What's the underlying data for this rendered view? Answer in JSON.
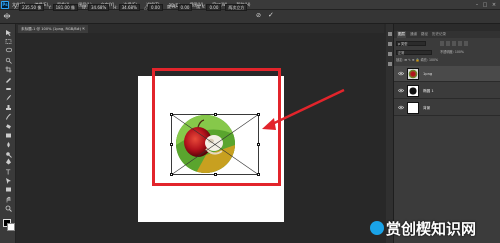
{
  "app": {
    "logo": "Ps"
  },
  "menu": {
    "items": [
      "文件(F)",
      "编辑(E)",
      "图像(I)",
      "图层(L)",
      "文字(Y)",
      "选择(S)",
      "滤镜(T)",
      "3D(D)",
      "视图(V)",
      "窗口(W)",
      "帮助(H)"
    ]
  },
  "options": {
    "fields": [
      {
        "label": "X:",
        "value": "235.50 像"
      },
      {
        "label": "Y:",
        "value": "181.00 像"
      },
      {
        "label": "W:",
        "value": "34.68%"
      },
      {
        "label": "H:",
        "value": "34.68%"
      },
      {
        "label": "△",
        "value": "0.00"
      },
      {
        "label": "度 H:",
        "value": "0.00"
      },
      {
        "label": "度 V:",
        "value": "0.00"
      }
    ],
    "interp": "两次立方",
    "cancel_icon": "⊘",
    "commit_icon": "✓"
  },
  "document": {
    "tab_title": "未标题-1 @ 100% (1png, RGB/8#) *",
    "close": "×"
  },
  "layers_panel": {
    "tabs": [
      "图层",
      "通道",
      "路径",
      "历史记录"
    ],
    "active_tab": "图层",
    "filter": "ρ 类型",
    "blend": "正常",
    "opacity": "不透明度: 100%",
    "lock": "锁定:  ⊞ ✎ ⊕ 🔒   填充: 100%",
    "layers": [
      {
        "name": "1png",
        "thumb": "photo",
        "selected": true
      },
      {
        "name": "椭圆 1",
        "thumb": "ellipse",
        "selected": false
      },
      {
        "name": "背景",
        "thumb": "white",
        "selected": false
      }
    ]
  },
  "watermark": {
    "text": "赏创楔知识网"
  },
  "colors": {
    "highlight": "#e2242b",
    "ps_blue": "#2fa3f7"
  }
}
